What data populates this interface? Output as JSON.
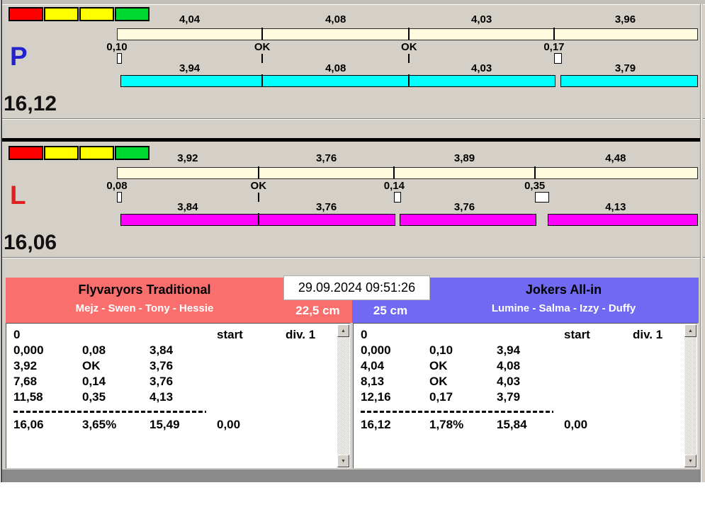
{
  "colors": {
    "indicator": [
      "#ff0000",
      "#ffff00",
      "#ffff00",
      "#00d832"
    ],
    "reference_bar": "#fffbdf",
    "lane_p_bar": "#00ffff",
    "lane_l_bar": "#ff00ff",
    "lane_p_letter": "#2222cf",
    "lane_l_letter": "#e02020",
    "team_left_header": "#f96f6e",
    "team_right_header": "#6f6af1"
  },
  "icons": {
    "scroll_up": "▲",
    "scroll_down": "▼"
  },
  "lanes": [
    {
      "letter": "P",
      "letter_color": "#2222cf",
      "total": "16,12",
      "bar_color": "#00ffff",
      "top_values": [
        "4,04",
        "4,08",
        "4,03",
        "3,96"
      ],
      "joints": [
        "0,10",
        "OK",
        "OK",
        "0,17"
      ],
      "bottom_values": [
        "3,94",
        "4,08",
        "4,03",
        "3,79"
      ]
    },
    {
      "letter": "L",
      "letter_color": "#e02020",
      "total": "16,06",
      "bar_color": "#ff00ff",
      "top_values": [
        "3,92",
        "3,76",
        "3,89",
        "4,48"
      ],
      "joints": [
        "0,08",
        "OK",
        "0,14",
        "0,35"
      ],
      "bottom_values": [
        "3,84",
        "3,76",
        "3,76",
        "4,13"
      ]
    }
  ],
  "scoreboard": {
    "datetime": "29.09.2024 09:51:26",
    "teams": [
      {
        "name": "Flyvaryors Traditional",
        "members": "Mejz - Swen - Tony - Hessie",
        "header_color": "#f96f6e",
        "size": "22,5 cm",
        "info_row": {
          "c1": "0",
          "start": "start",
          "div": "div. 1"
        },
        "rows": [
          [
            "0,000",
            "0,08",
            "3,84"
          ],
          [
            "3,92",
            "OK",
            "3,76"
          ],
          [
            "7,68",
            "0,14",
            "3,76"
          ],
          [
            "11,58",
            "0,35",
            "4,13"
          ]
        ],
        "totals": [
          "16,06",
          "3,65%",
          "15,49",
          "0,00"
        ]
      },
      {
        "name": "Jokers All-in",
        "members": "Lumine - Salma - Izzy - Duffy",
        "header_color": "#6f6af1",
        "size": "25 cm",
        "info_row": {
          "c1": "0",
          "start": "start",
          "div": "div. 1"
        },
        "rows": [
          [
            "0,000",
            "0,10",
            "3,94"
          ],
          [
            "4,04",
            "OK",
            "4,08"
          ],
          [
            "8,13",
            "OK",
            "4,03"
          ],
          [
            "12,16",
            "0,17",
            "3,79"
          ]
        ],
        "totals": [
          "16,12",
          "1,78%",
          "15,84",
          "0,00"
        ]
      }
    ]
  }
}
